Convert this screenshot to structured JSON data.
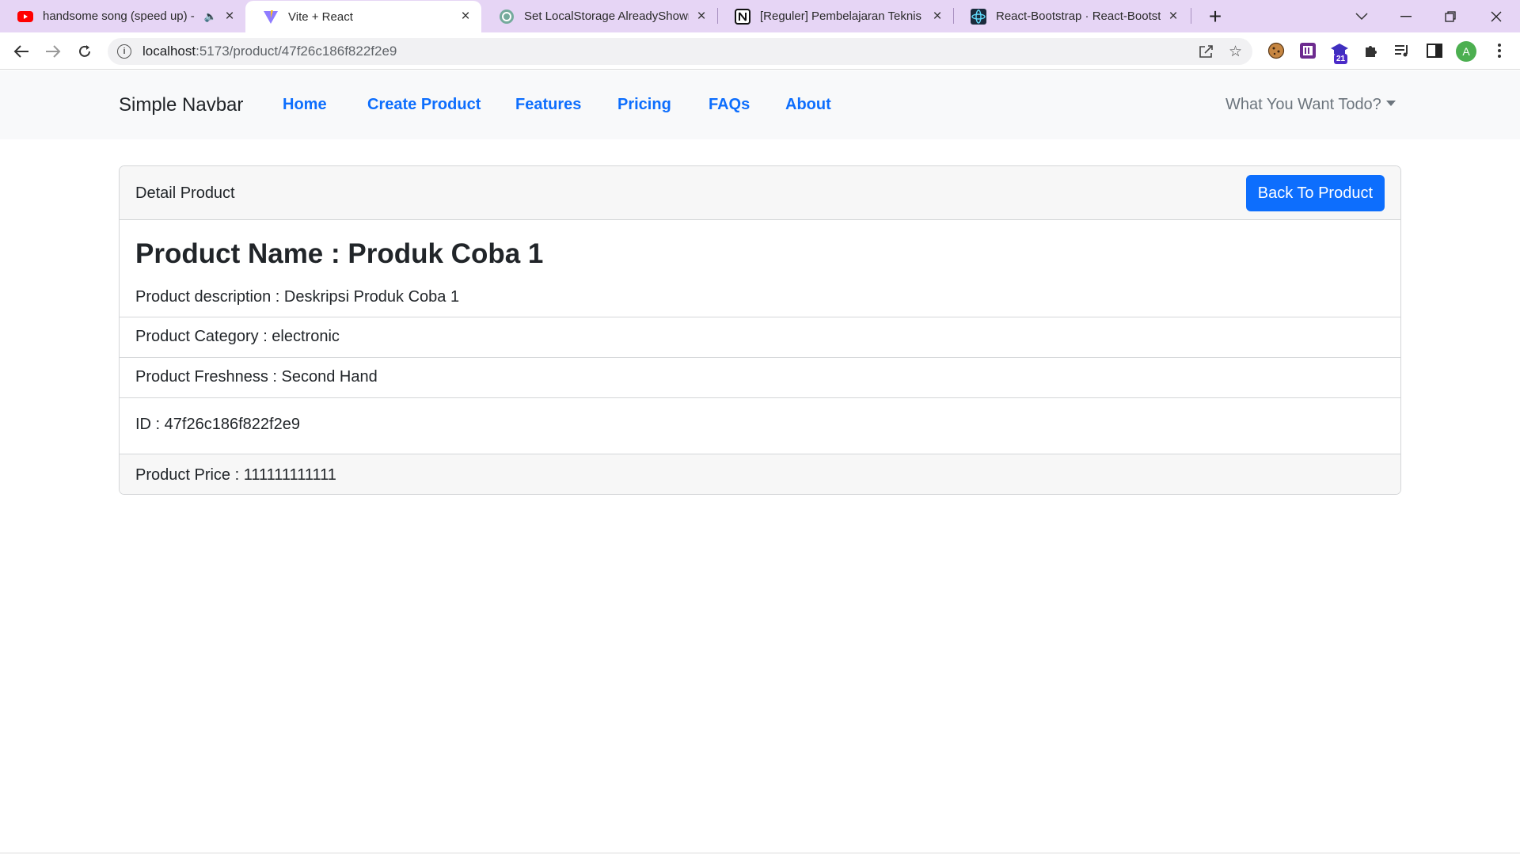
{
  "browser": {
    "tabs": [
      {
        "title": "handsome song (speed up) -",
        "icon": "youtube-icon"
      },
      {
        "title": "Vite + React",
        "icon": "vite-icon"
      },
      {
        "title": "Set LocalStorage AlreadyShown.",
        "icon": "chatgpt-icon"
      },
      {
        "title": "[Reguler] Pembelajaran Teknis Re",
        "icon": "notion-icon"
      },
      {
        "title": "React-Bootstrap · React-Bootstrap",
        "icon": "react-bootstrap-icon"
      }
    ],
    "url_host": "localhost",
    "url_path": ":5173/product/47f26c186f822f2e9",
    "extension_badge": "21",
    "profile_initial": "A"
  },
  "navbar": {
    "brand": "Simple Navbar",
    "links": [
      "Home",
      "Create Product",
      "Features",
      "Pricing",
      "FAQs",
      "About"
    ],
    "dropdown_label": "What You Want Todo?"
  },
  "card": {
    "header_title": "Detail Product",
    "back_button": "Back To Product",
    "product_name": "Product Name : Produk Coba 1",
    "description": "Product description : Deskripsi Produk Coba 1",
    "category": "Product Category : electronic",
    "freshness": "Product Freshness : Second Hand",
    "id": "ID : 47f26c186f822f2e9",
    "price": "Product Price : 111111111111"
  },
  "colors": {
    "tabstrip": "#e6d5f5",
    "primary": "#0d6efd",
    "navbar_bg": "#f8f9fa"
  }
}
